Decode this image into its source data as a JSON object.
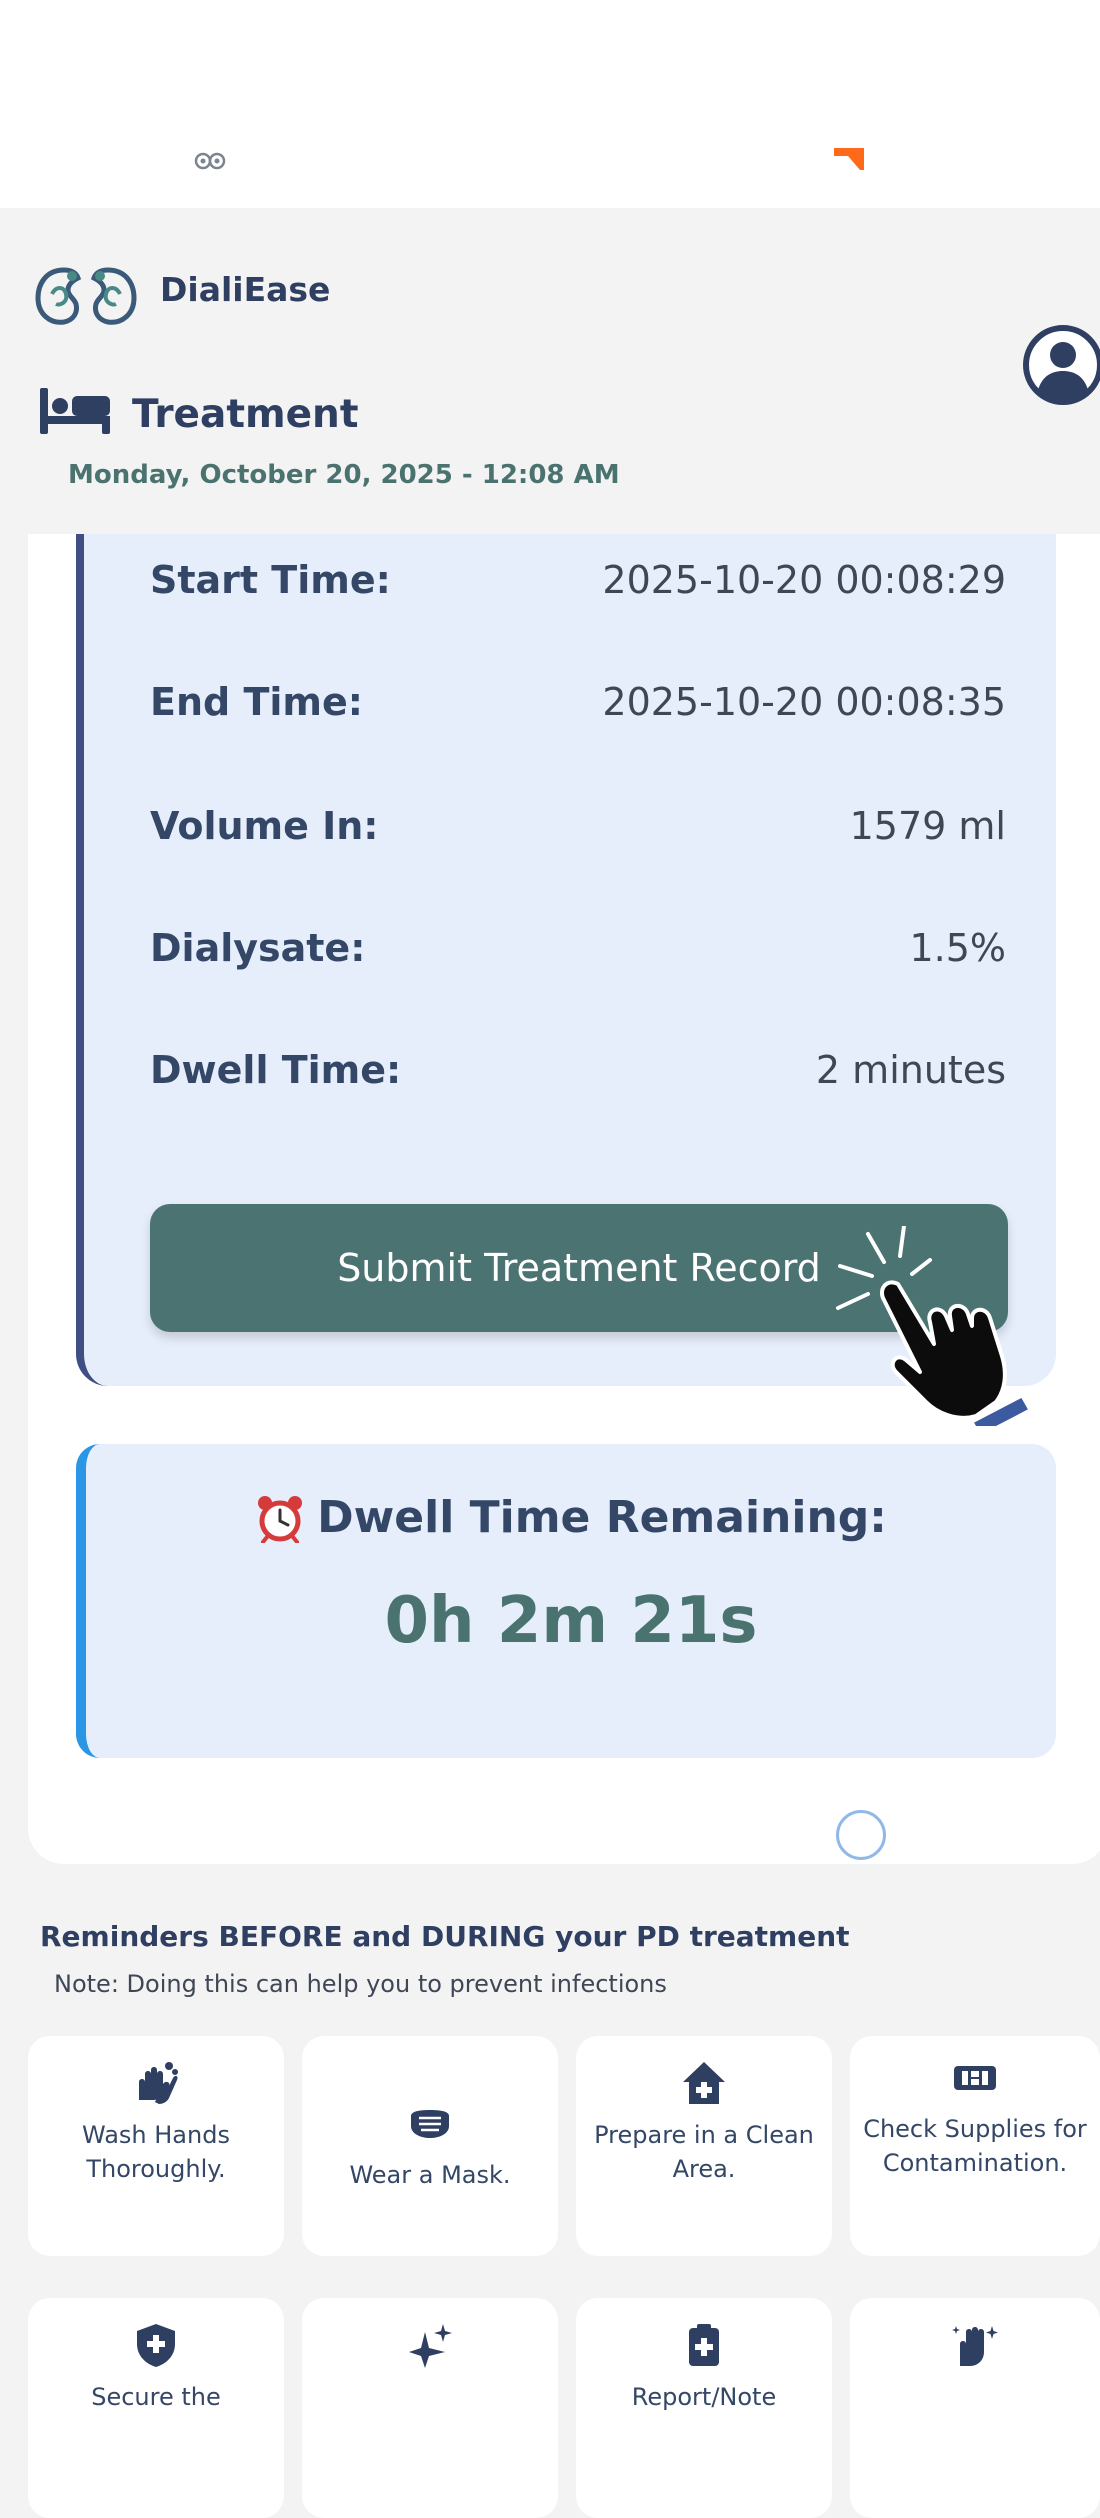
{
  "colors": {
    "brand_navy": "#2f3f62",
    "brand_teal": "#4a7372",
    "card_background": "#e6eefb",
    "dwell_accent": "#2b96e6",
    "details_accent": "#3f4f83",
    "status_orange": "#ff6a1a"
  },
  "header": {
    "app_name": "DialiEase",
    "logo_icon": "kidney-logo-icon",
    "avatar_icon": "user-avatar-icon"
  },
  "page": {
    "icon": "bed-icon",
    "title": "Treatment",
    "date": "Monday, October 20, 2025 - 12:08 AM"
  },
  "treatment_details": [
    {
      "label": "Start Time:",
      "value": "2025-10-20 00:08:29"
    },
    {
      "label": "End Time:",
      "value": "2025-10-20 00:08:35"
    },
    {
      "label": "Volume In:",
      "value": "1579 ml"
    },
    {
      "label": "Dialysate:",
      "value": "1.5%"
    },
    {
      "label": "Dwell Time:",
      "value": "2 minutes"
    }
  ],
  "submit_button": {
    "label": "Submit Treatment Record"
  },
  "dwell": {
    "icon": "alarm-clock-icon",
    "title": "Dwell Time Remaining:",
    "countdown": "0h 2m 21s"
  },
  "reminders": {
    "title": "Reminders BEFORE and DURING your PD treatment",
    "note": "Note: Doing this can help you to prevent infections",
    "items": [
      {
        "icon": "hand-washing-icon",
        "label": "Wash Hands Thoroughly."
      },
      {
        "icon": "mask-icon",
        "label": "Wear a Mask."
      },
      {
        "icon": "home-medical-icon",
        "label": "Prepare in a Clean Area."
      },
      {
        "icon": "supplies-icon",
        "label": "Check Supplies for Contamination."
      },
      {
        "icon": "shield-icon",
        "label": "Secure the"
      },
      {
        "icon": "sparkle-icon",
        "label": ""
      },
      {
        "icon": "clipboard-medical-icon",
        "label": "Report/Note"
      },
      {
        "icon": "hand-sparkle-icon",
        "label": ""
      }
    ]
  }
}
